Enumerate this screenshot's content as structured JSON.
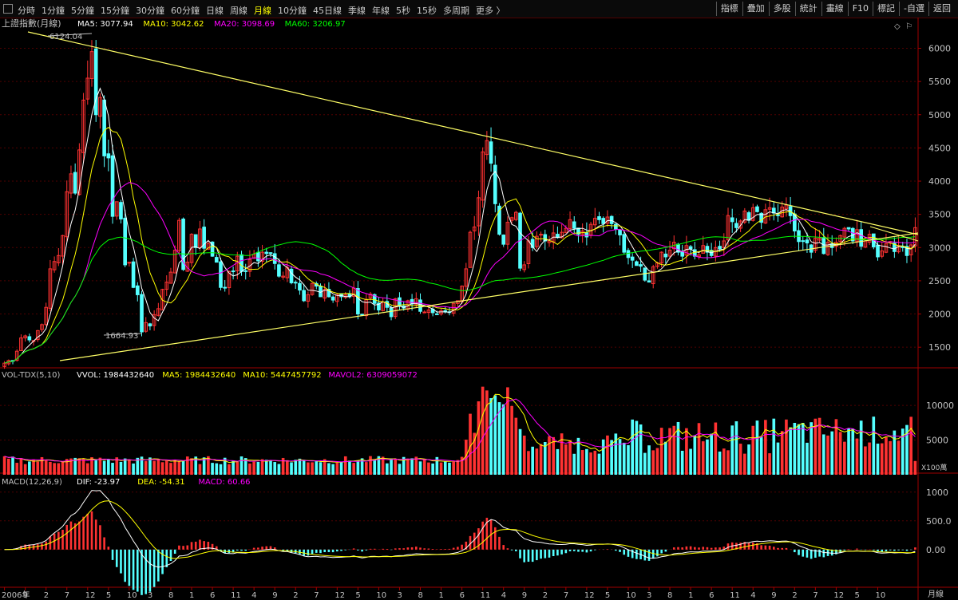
{
  "toolbar": {
    "periods": [
      "分時",
      "1分鐘",
      "5分鐘",
      "15分鐘",
      "30分鐘",
      "60分鐘",
      "日線",
      "周線",
      "月線",
      "10分鐘",
      "45日線",
      "季線",
      "年線",
      "5秒",
      "15秒",
      "多周期",
      "更多 〉"
    ],
    "active_period": "月線",
    "right_buttons": [
      "指標",
      "疊加",
      "多股",
      "統計",
      "畫線",
      "F10",
      "標記",
      "-自選",
      "返回"
    ]
  },
  "main_panel": {
    "title": "上證指數(月線)",
    "ma_legend": [
      {
        "label": "MA5: 3077.94",
        "color": "#ffffff"
      },
      {
        "label": "MA10: 3042.62",
        "color": "#ffff00"
      },
      {
        "label": "MA20: 3098.69",
        "color": "#ff00ff"
      },
      {
        "label": "MA60: 3206.97",
        "color": "#00ff00"
      }
    ],
    "high_label": "6124.04",
    "low_label": "1664.93",
    "y_ticks": [
      "6000",
      "5500",
      "5000",
      "4500",
      "4000",
      "3500",
      "3000",
      "2500",
      "2000",
      "1500"
    ]
  },
  "vol_panel": {
    "title": "VOL-TDX(5,10)",
    "legend": [
      {
        "label": "VVOL: 1984432640",
        "color": "#ffffff"
      },
      {
        "label": "MA5: 1984432640",
        "color": "#ffff00"
      },
      {
        "label": "MA10: 5447457792",
        "color": "#ffff00"
      },
      {
        "label": "MAVOL2: 6309059072",
        "color": "#ff00ff"
      }
    ],
    "y_ticks": [
      "10000",
      "5000"
    ],
    "unit": "X100萬"
  },
  "macd_panel": {
    "title": "MACD(12,26,9)",
    "legend": [
      {
        "label": "DIF: -23.97",
        "color": "#ffffff"
      },
      {
        "label": "DEA: -54.31",
        "color": "#ffff00"
      },
      {
        "label": "MACD: 60.66",
        "color": "#ff00ff"
      }
    ],
    "y_ticks": [
      "1000",
      "500.0",
      "0.00"
    ]
  },
  "x_axis": {
    "labels": [
      "2006年",
      "9",
      "2",
      "7",
      "12",
      "5",
      "10",
      "3",
      "8",
      "1",
      "6",
      "11",
      "4",
      "9",
      "2",
      "7",
      "12",
      "5",
      "10",
      "3",
      "8",
      "1",
      "6",
      "11",
      "4",
      "9",
      "2",
      "7",
      "12",
      "5",
      "10",
      "3",
      "8",
      "1",
      "6",
      "11",
      "4",
      "9",
      "2",
      "7",
      "12",
      "5",
      "10"
    ],
    "period_label": "月線"
  },
  "colors": {
    "up": "#ff3232",
    "down": "#54ffff",
    "trend": "#ffff66",
    "ma5": "#ffffff",
    "ma10": "#ffff00",
    "ma20": "#ff00ff",
    "ma60": "#00ff00"
  },
  "chart_data": {
    "type": "candlestick",
    "title": "上證指數(月線)",
    "period": "monthly",
    "start": "2006-01",
    "note_values": "approximate monthly close values read from chart",
    "closes": [
      1260,
      1300,
      1300,
      1440,
      1640,
      1670,
      1610,
      1600,
      1750,
      1840,
      2100,
      2680,
      2790,
      2880,
      3180,
      3840,
      4110,
      3820,
      4470,
      5220,
      5550,
      5950,
      5000,
      5260,
      4380,
      4350,
      3470,
      3690,
      3430,
      2740,
      2780,
      2400,
      2290,
      1730,
      1870,
      1820,
      1990,
      2080,
      2370,
      2480,
      2630,
      2960,
      3410,
      2670,
      2780,
      3200,
      3000,
      3280,
      2990,
      3060,
      2870,
      2780,
      2400,
      2400,
      2640,
      2640,
      2870,
      2640,
      2640,
      2820,
      2900,
      2800,
      2930,
      2910,
      2910,
      2760,
      2570,
      2570,
      2700,
      2470,
      2470,
      2360,
      2200,
      2290,
      2460,
      2420,
      2260,
      2370,
      2260,
      2210,
      2290,
      2260,
      2290,
      2260,
      2390,
      2000,
      1990,
      2220,
      2300,
      2160,
      2060,
      2180,
      2100,
      1960,
      2230,
      2120,
      2090,
      2200,
      2150,
      2230,
      2040,
      2030,
      2060,
      2020,
      2000,
      2050,
      2030,
      2030,
      2160,
      2200,
      2420,
      2680,
      3230,
      3310,
      3750,
      4440,
      4610,
      4270,
      3660,
      3200,
      3050,
      3380,
      3450,
      3530,
      2690,
      2740,
      3100,
      3000,
      3170,
      3200,
      3100,
      3100,
      3220,
      3150,
      3230,
      3290,
      3420,
      3290,
      3200,
      3250,
      3160,
      3350,
      3440,
      3420,
      3360,
      3460,
      3360,
      3280,
      3190,
      2930,
      2850,
      2810,
      2730,
      2720,
      2510,
      2480,
      2710,
      2770,
      2930,
      2860,
      2960,
      3080,
      2930,
      2870,
      3030,
      2980,
      2870,
      2890,
      3030,
      2930,
      2880,
      3000,
      2980,
      3100,
      3480,
      3390,
      3300,
      3400,
      3550,
      3410,
      3600,
      3540,
      3380,
      3570,
      3600,
      3520,
      3480,
      3610,
      3640,
      3480,
      3250,
      3090,
      3100,
      3070,
      2930,
      3140,
      3140,
      2910,
      3080,
      3000,
      3080,
      3180,
      3290,
      3280,
      3100,
      3270,
      3020,
      3100,
      3200,
      3010,
      2860,
      2950,
      3060,
      3090,
      2940,
      3030,
      3000,
      2880,
      3040,
      3300
    ]
  }
}
